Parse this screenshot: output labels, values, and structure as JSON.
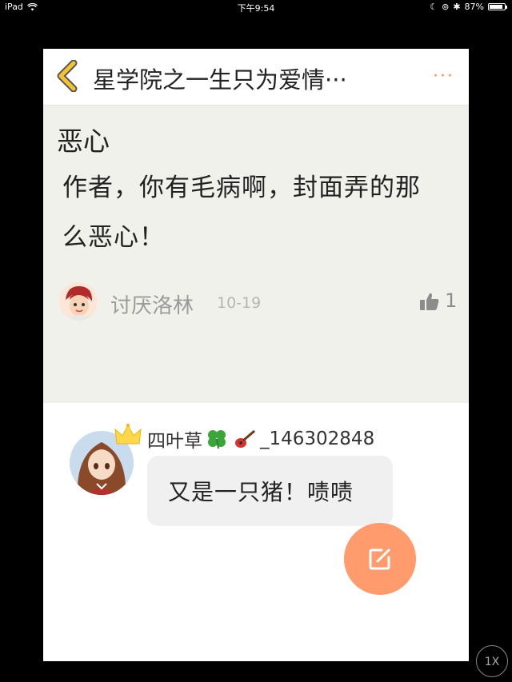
{
  "status_bar": {
    "device": "iPad",
    "time": "下午9:54",
    "battery": "87%",
    "battery_level": 0.87
  },
  "header": {
    "title": "星学院之一生只为爱情",
    "title_more": "···",
    "more_label": "···"
  },
  "post": {
    "title": "恶心",
    "body": "作者，你有毛病啊，封面弄的那么恶心！",
    "author": "讨厌洛林",
    "date": "10-19",
    "likes": "1"
  },
  "reply": {
    "name_prefix": "四叶草",
    "name_suffix": "_146302848",
    "text": "又是一只猪！啧啧"
  },
  "zoom_label": "1X",
  "colors": {
    "accent": "#ff9b6c",
    "back_icon": "#f4c430",
    "post_bg": "#f1f1ec"
  }
}
